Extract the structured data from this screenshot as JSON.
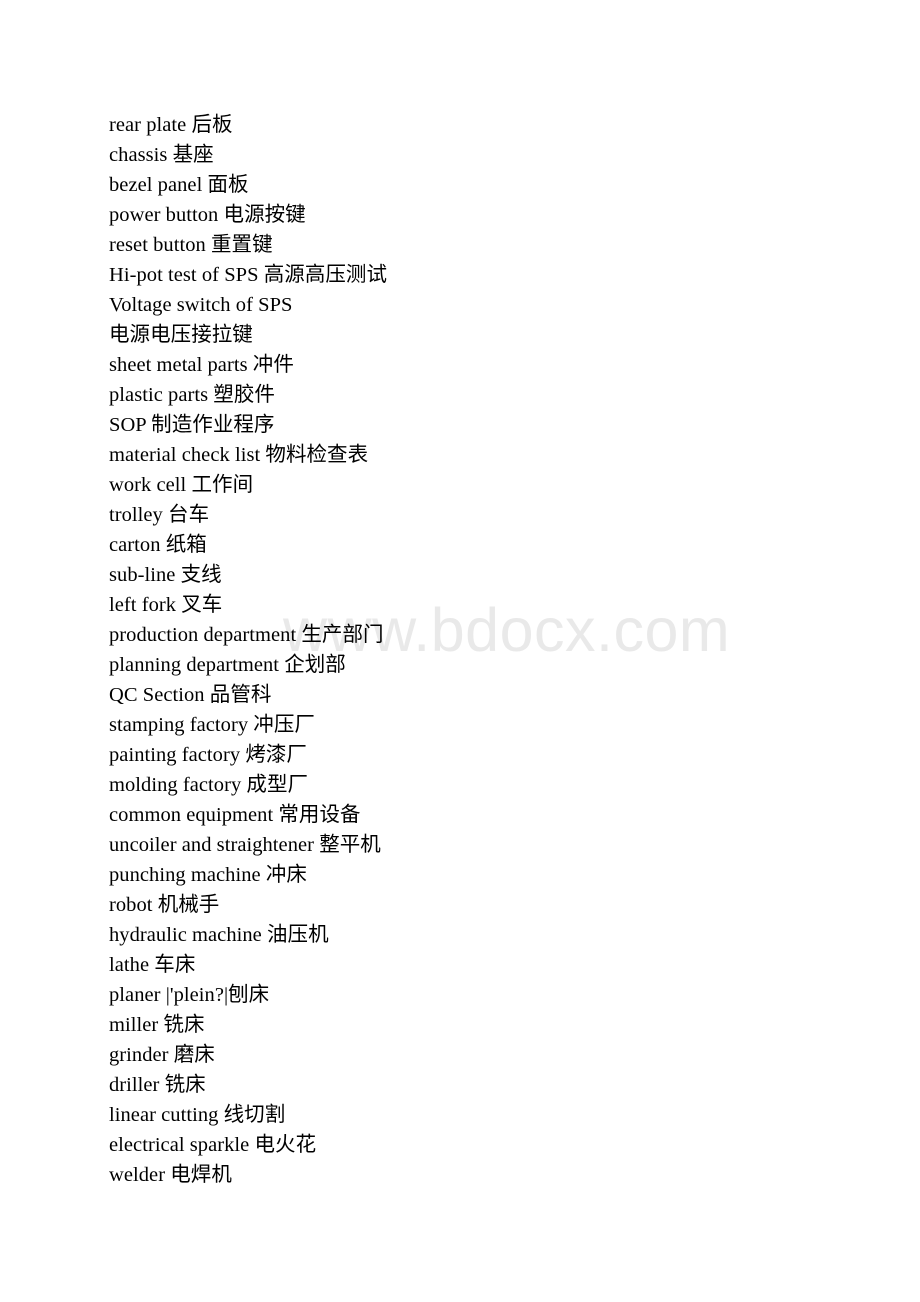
{
  "page": {
    "background_color": "#ffffff",
    "text_color": "#000000",
    "document_type": "bilingual-glossary",
    "subject": "manufacturing and factory terminology"
  },
  "watermark": {
    "text": "www.bdocx.com",
    "color": "#e9e9e9"
  },
  "glossary": {
    "lines": [
      "rear plate 后板",
      "chassis 基座",
      "bezel panel 面板",
      "power button 电源按键",
      "reset button 重置键",
      "Hi-pot test of SPS 高源高压测试",
      "Voltage switch of SPS",
      "电源电压接拉键",
      "sheet metal parts 冲件",
      "plastic parts 塑胶件",
      "SOP 制造作业程序",
      "material check list 物料检查表",
      "work cell 工作间",
      "trolley 台车",
      "carton 纸箱",
      "sub-line 支线",
      "left fork 叉车",
      "production department 生产部门",
      "planning department 企划部",
      "QC Section 品管科",
      "stamping factory 冲压厂",
      "painting factory 烤漆厂",
      "molding factory 成型厂",
      "common equipment 常用设备",
      "uncoiler and straightener 整平机",
      "punching machine 冲床",
      "robot 机械手",
      "hydraulic machine 油压机",
      "lathe 车床",
      "planer |'plein?|刨床",
      "miller 铣床",
      "grinder 磨床",
      "driller 铣床",
      "linear cutting 线切割",
      "electrical sparkle 电火花",
      "welder 电焊机"
    ]
  }
}
